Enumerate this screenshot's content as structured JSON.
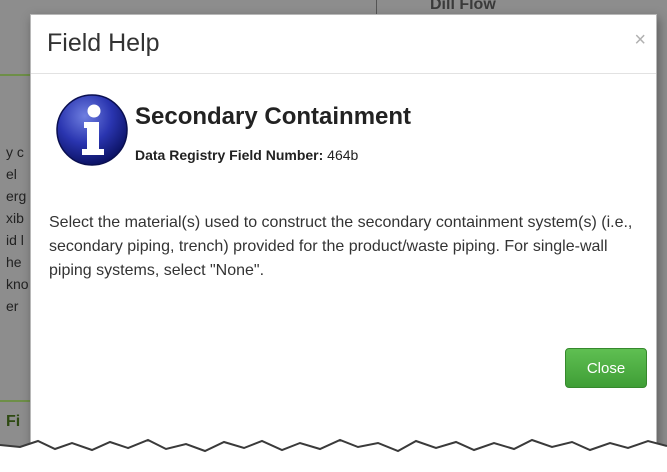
{
  "background": {
    "header_text": "Dill Flow",
    "fragments": [
      "y c",
      "el",
      "erg",
      "xib",
      "id l",
      "he",
      "kno",
      "er"
    ],
    "footer_text": "Fi"
  },
  "modal": {
    "title": "Field Help",
    "close_symbol": "×",
    "icon": "info-icon",
    "help_title": "Secondary Containment",
    "field_number_label": "Data Registry Field Number:",
    "field_number_value": "464b",
    "body_text": "Select the material(s) used to construct the secondary containment system(s) (i.e., secondary piping, trench) provided for the product/waste piping. For single-wall piping systems, select \"None\".",
    "close_button_label": "Close",
    "accent_color": "#4aa83f"
  }
}
